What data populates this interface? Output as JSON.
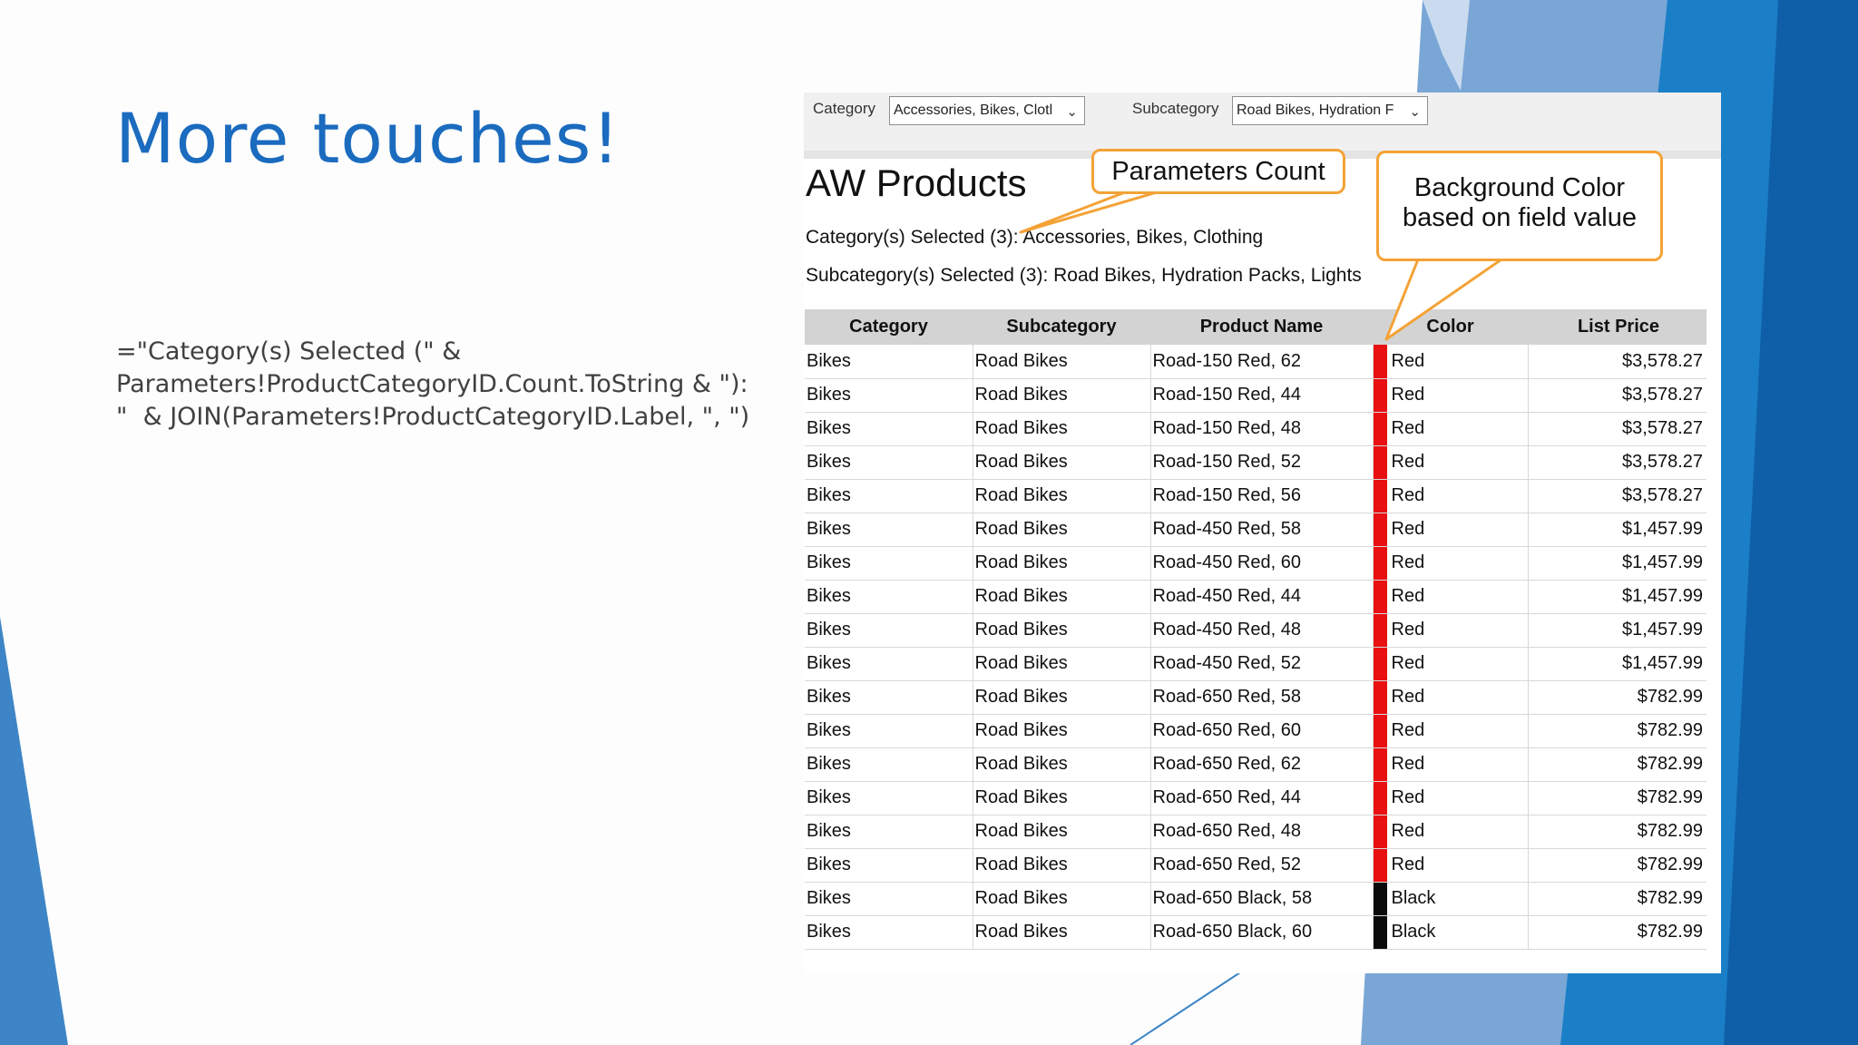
{
  "slide": {
    "title": "More touches!",
    "code_lines": [
      "=\"Category(s) Selected (\" &",
      "Parameters!ProductCategoryID.Count.ToString & \"):",
      "\"  & JOIN(Parameters!ProductCategoryID.Label, \", \")"
    ]
  },
  "params": {
    "category_label": "Category",
    "category_value": "Accessories, Bikes, Clotl",
    "subcategory_label": "Subcategory",
    "subcategory_value": "Road Bikes, Hydration F"
  },
  "report": {
    "title": "AW Products",
    "category_selected": "Category(s) Selected (3): Accessories, Bikes, Clothing",
    "subcategory_selected": "Subcategory(s) Selected (3): Road Bikes, Hydration Packs, Lights",
    "columns": [
      "Category",
      "Subcategory",
      "Product Name",
      "Color",
      "List Price"
    ],
    "rows": [
      {
        "category": "Bikes",
        "subcategory": "Road Bikes",
        "product": "Road-150 Red, 62",
        "color": "Red",
        "swatch": "#e81010",
        "price": "$3,578.27"
      },
      {
        "category": "Bikes",
        "subcategory": "Road Bikes",
        "product": "Road-150 Red, 44",
        "color": "Red",
        "swatch": "#e81010",
        "price": "$3,578.27"
      },
      {
        "category": "Bikes",
        "subcategory": "Road Bikes",
        "product": "Road-150 Red, 48",
        "color": "Red",
        "swatch": "#e81010",
        "price": "$3,578.27"
      },
      {
        "category": "Bikes",
        "subcategory": "Road Bikes",
        "product": "Road-150 Red, 52",
        "color": "Red",
        "swatch": "#e81010",
        "price": "$3,578.27"
      },
      {
        "category": "Bikes",
        "subcategory": "Road Bikes",
        "product": "Road-150 Red, 56",
        "color": "Red",
        "swatch": "#e81010",
        "price": "$3,578.27"
      },
      {
        "category": "Bikes",
        "subcategory": "Road Bikes",
        "product": "Road-450 Red, 58",
        "color": "Red",
        "swatch": "#e81010",
        "price": "$1,457.99"
      },
      {
        "category": "Bikes",
        "subcategory": "Road Bikes",
        "product": "Road-450 Red, 60",
        "color": "Red",
        "swatch": "#e81010",
        "price": "$1,457.99"
      },
      {
        "category": "Bikes",
        "subcategory": "Road Bikes",
        "product": "Road-450 Red, 44",
        "color": "Red",
        "swatch": "#e81010",
        "price": "$1,457.99"
      },
      {
        "category": "Bikes",
        "subcategory": "Road Bikes",
        "product": "Road-450 Red, 48",
        "color": "Red",
        "swatch": "#e81010",
        "price": "$1,457.99"
      },
      {
        "category": "Bikes",
        "subcategory": "Road Bikes",
        "product": "Road-450 Red, 52",
        "color": "Red",
        "swatch": "#e81010",
        "price": "$1,457.99"
      },
      {
        "category": "Bikes",
        "subcategory": "Road Bikes",
        "product": "Road-650 Red, 58",
        "color": "Red",
        "swatch": "#e81010",
        "price": "$782.99"
      },
      {
        "category": "Bikes",
        "subcategory": "Road Bikes",
        "product": "Road-650 Red, 60",
        "color": "Red",
        "swatch": "#e81010",
        "price": "$782.99"
      },
      {
        "category": "Bikes",
        "subcategory": "Road Bikes",
        "product": "Road-650 Red, 62",
        "color": "Red",
        "swatch": "#e81010",
        "price": "$782.99"
      },
      {
        "category": "Bikes",
        "subcategory": "Road Bikes",
        "product": "Road-650 Red, 44",
        "color": "Red",
        "swatch": "#e81010",
        "price": "$782.99"
      },
      {
        "category": "Bikes",
        "subcategory": "Road Bikes",
        "product": "Road-650 Red, 48",
        "color": "Red",
        "swatch": "#e81010",
        "price": "$782.99"
      },
      {
        "category": "Bikes",
        "subcategory": "Road Bikes",
        "product": "Road-650 Red, 52",
        "color": "Red",
        "swatch": "#e81010",
        "price": "$782.99"
      },
      {
        "category": "Bikes",
        "subcategory": "Road Bikes",
        "product": "Road-650 Black, 58",
        "color": "Black",
        "swatch": "#0a0a0a",
        "price": "$782.99"
      },
      {
        "category": "Bikes",
        "subcategory": "Road Bikes",
        "product": "Road-650 Black, 60",
        "color": "Black",
        "swatch": "#0a0a0a",
        "price": "$782.99"
      }
    ]
  },
  "callouts": {
    "params_count": "Parameters Count",
    "bg_color_line1": "Background Color",
    "bg_color_line2": "based on field value"
  },
  "colors": {
    "title_blue": "#1b6bbf",
    "callout_border": "#f4a236",
    "header_gray": "#d3d3d3"
  }
}
